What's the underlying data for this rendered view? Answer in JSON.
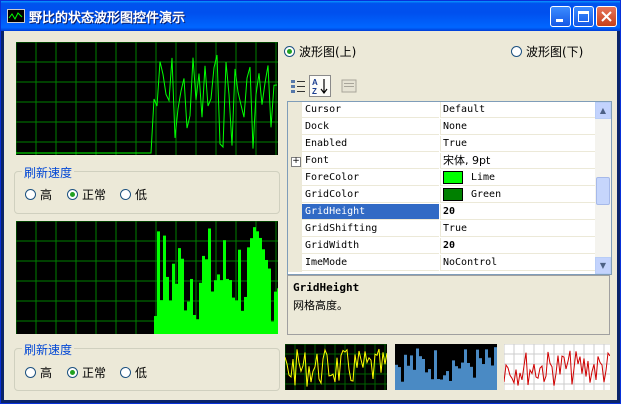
{
  "window": {
    "title": "野比的状态波形图控件演示"
  },
  "colors": {
    "titlebar": "#0058ee",
    "client": "#ece9d8",
    "lime": "#00ff00",
    "green": "#008000",
    "selection": "#316ac5",
    "group_label": "#0046d5"
  },
  "refresh_group_1": {
    "label": "刷新速度",
    "options": [
      "高",
      "正常",
      "低"
    ],
    "selected": "正常"
  },
  "refresh_group_2": {
    "label": "刷新速度",
    "options": [
      "高",
      "正常",
      "低"
    ],
    "selected": "正常"
  },
  "waveform_selector": {
    "upper": "波形图(上)",
    "lower": "波形图(下)",
    "selected": "upper"
  },
  "toolbar": {
    "icons": [
      "categorized-icon",
      "alphabetical-icon",
      "property-pages-icon"
    ]
  },
  "property_grid": {
    "rows": [
      {
        "name": "Cursor",
        "value": "Default"
      },
      {
        "name": "Dock",
        "value": "None"
      },
      {
        "name": "Enabled",
        "value": "True"
      },
      {
        "name": "Font",
        "value": "宋体, 9pt"
      },
      {
        "name": "ForeColor",
        "value": "Lime"
      },
      {
        "name": "GridColor",
        "value": "Green"
      },
      {
        "name": "GridHeight",
        "value": "20"
      },
      {
        "name": "GridShifting",
        "value": "True"
      },
      {
        "name": "GridWidth",
        "value": "20"
      },
      {
        "name": "ImeMode",
        "value": "NoControl"
      }
    ],
    "selected": "GridHeight"
  },
  "description": {
    "title": "GridHeight",
    "text": "网格高度。"
  }
}
